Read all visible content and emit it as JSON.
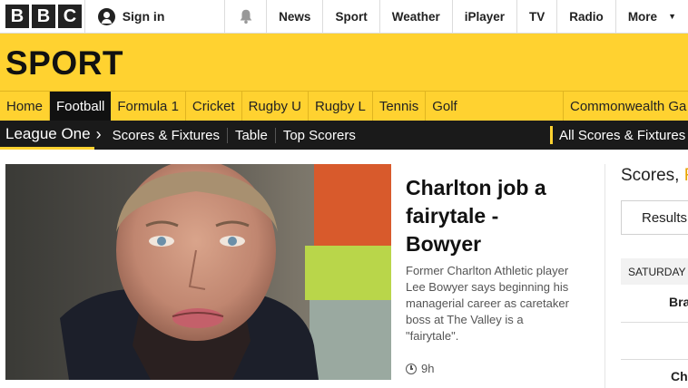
{
  "masthead": {
    "logo_letters": [
      "B",
      "B",
      "C"
    ],
    "signin_label": "Sign in",
    "nav": [
      "News",
      "Sport",
      "Weather",
      "iPlayer",
      "TV",
      "Radio"
    ],
    "more_label": "More"
  },
  "section": {
    "title": "SPORT"
  },
  "sport_nav": {
    "items": [
      "Home",
      "Football",
      "Formula 1",
      "Cricket",
      "Rugby U",
      "Rugby L",
      "Tennis",
      "Golf"
    ],
    "active": "Football",
    "right_item": "Commonwealth Ga"
  },
  "league_nav": {
    "title": "League One",
    "items": [
      "Scores & Fixtures",
      "Table",
      "Top Scorers"
    ],
    "right_item": "All Scores & Fixtures"
  },
  "story": {
    "headline": "Charlton job a fairytale - Bowyer",
    "summary": "Former Charlton Athletic player Lee Bowyer says beginning his managerial career as caretaker boss at The Valley is a \"fairytale\".",
    "time": "9h"
  },
  "scores_panel": {
    "title_prefix": "Scores, ",
    "title_highlight": "R",
    "results_label": "Results",
    "date_label": "SATURDAY",
    "team_1": "Bra",
    "team_2": "Ch"
  },
  "colors": {
    "brand_yellow": "#ffd230",
    "dark": "#1a1a1a"
  }
}
